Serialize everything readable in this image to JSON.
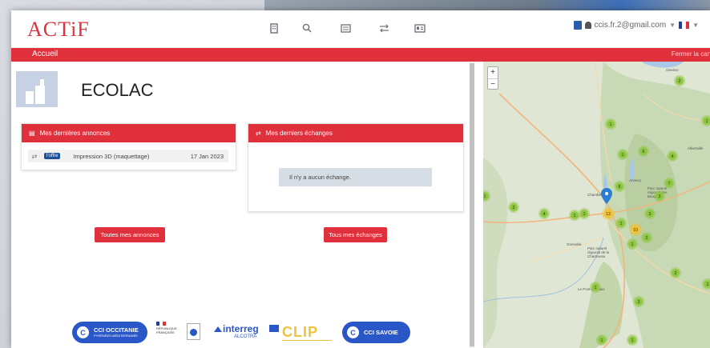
{
  "header": {
    "logo": "ACTiF",
    "user_email": "ccis.fr.2@gmail.com",
    "nav_icons": [
      "building-icon",
      "search-icon",
      "list-icon",
      "exchange-icon",
      "id-card-icon"
    ]
  },
  "breadcrumb": {
    "home": "Accueil",
    "close_map": "Fermer la carte"
  },
  "company": {
    "name": "ECOLAC"
  },
  "ads_panel": {
    "title": "Mes dernières annonces",
    "items": [
      {
        "badge": "l'offre",
        "title": "Impression 3D (maquettage)",
        "date": "17 Jan 2023"
      }
    ],
    "button": "Toutes mes annonces"
  },
  "exchanges_panel": {
    "title": "Mes derniers échanges",
    "empty_message": "Il n'y a aucun échange.",
    "button": "Tous mes échanges"
  },
  "footer_logos": {
    "cci_occitanie": "CCI OCCITANIE",
    "cci_occitanie_sub": "PYRÉNÉES-MÉDITERRANÉE",
    "republique": "RÉPUBLIQUE FRANÇAISE",
    "interreg": "interreg",
    "alcotra": "ALCOTRA",
    "clip": "CLIP",
    "cci_savoie": "CCI SAVOIE"
  },
  "map": {
    "clusters": [
      {
        "label": "2"
      },
      {
        "label": "1"
      },
      {
        "label": "1"
      },
      {
        "label": "1"
      },
      {
        "label": "6"
      },
      {
        "label": "4"
      },
      {
        "label": "7"
      },
      {
        "label": "3"
      },
      {
        "label": "6"
      },
      {
        "label": "1"
      },
      {
        "label": "2"
      },
      {
        "label": "4"
      },
      {
        "label": "1"
      },
      {
        "label": "1"
      },
      {
        "label": "13"
      },
      {
        "label": "1"
      },
      {
        "label": "3"
      },
      {
        "label": "10"
      },
      {
        "label": "2"
      },
      {
        "label": "1"
      },
      {
        "label": "2"
      },
      {
        "label": "1"
      },
      {
        "label": "3"
      },
      {
        "label": "1"
      },
      {
        "label": "1"
      },
      {
        "label": "1"
      }
    ],
    "place_labels": [
      "Genève",
      "Annecy",
      "Chambéry",
      "Grenoble",
      "Albertville",
      "Parc naturel régional des Bauges",
      "Parc naturel régional de la Chartreuse",
      "Le Pont-de-Claix"
    ]
  },
  "colors": {
    "brand_red": "#e0303c",
    "badge_blue": "#1e4f9a",
    "cluster_green": "#8dc63f",
    "cluster_yellow": "#f0c23a"
  }
}
